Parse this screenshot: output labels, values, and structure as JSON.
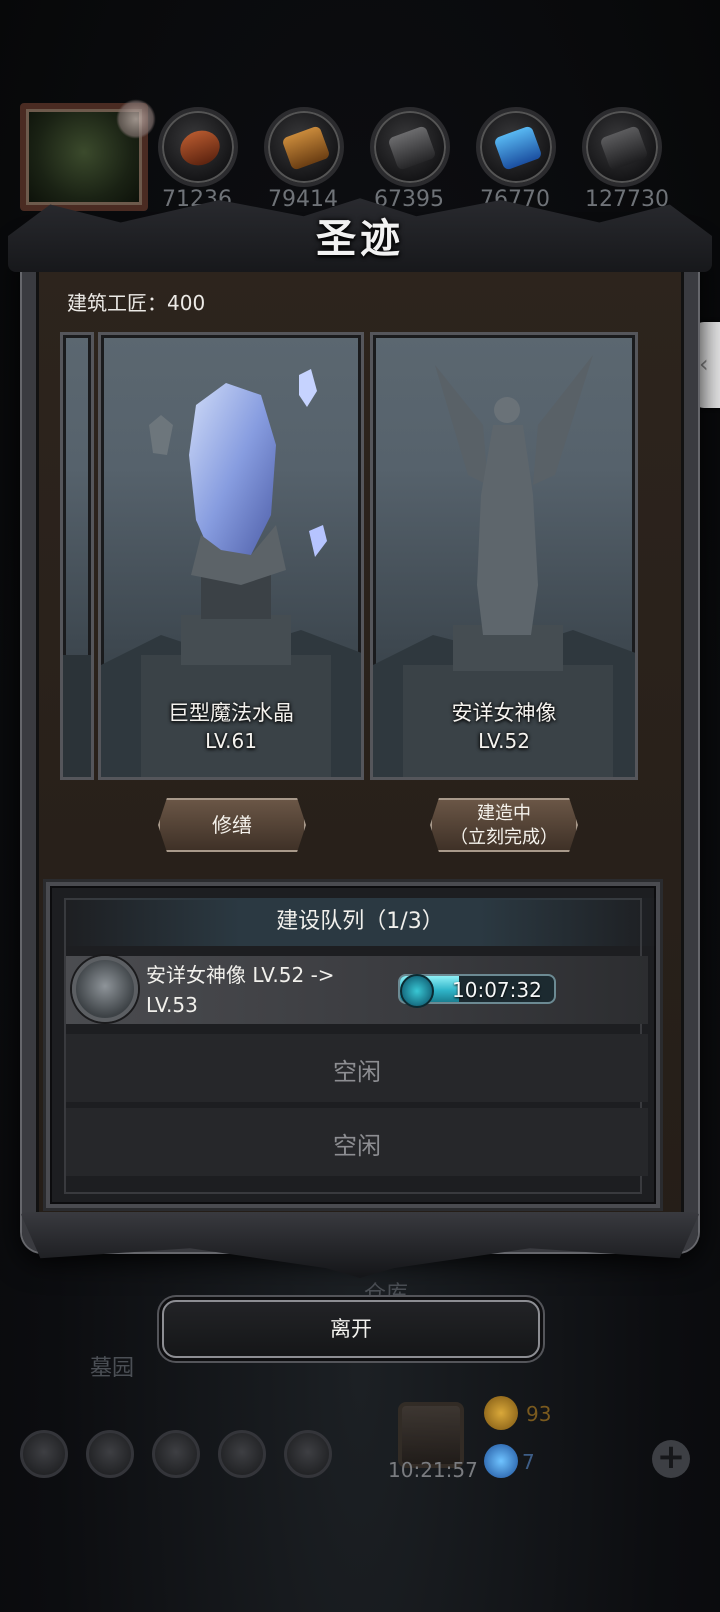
{
  "resources": {
    "values": [
      "71236",
      "79414",
      "67395",
      "76770",
      "127730"
    ],
    "icons": [
      "meat-icon",
      "wood-icon",
      "iron-icon",
      "crystal-icon",
      "stone-icon"
    ]
  },
  "panel": {
    "title": "圣迹",
    "craftsman": "建筑工匠：400"
  },
  "cards": [
    {
      "name": "巨型魔法水晶",
      "level": "LV.61",
      "action": "修缮"
    },
    {
      "name": "安详女神像",
      "level": "LV.52",
      "action_line1": "建造中",
      "action_line2": "（立刻完成）"
    }
  ],
  "queue": {
    "header": "建设队列（1/3）",
    "active": {
      "text": "安详女神像 LV.52 -> LV.53",
      "time": "10:07:32",
      "progress": 0.38
    },
    "idle_label_1": "空闲",
    "idle_label_2": "空闲"
  },
  "leave_label": "离开",
  "scene": {
    "warehouse": "仓库",
    "cemetery": "墓园",
    "gift_timer": "10:21:57",
    "gold": "93",
    "gems": "7",
    "side_tab_icon": "chevron-left-icon"
  },
  "colors": {
    "progress_fill": "#2fb4c8",
    "button_brown": "#5a4839",
    "panel_bg": "#2a221b"
  }
}
